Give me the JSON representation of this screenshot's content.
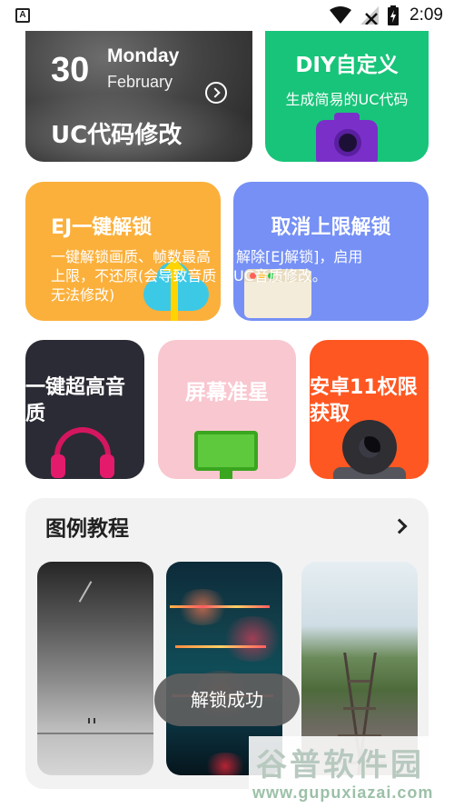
{
  "status_bar": {
    "app_badge": "A",
    "time": "2:09"
  },
  "date_card": {
    "day": "30",
    "weekday": "Monday",
    "month": "February",
    "title": "UC代码修改"
  },
  "diy_card": {
    "title": "DIY自定义",
    "subtitle": "生成简易的UC代码"
  },
  "ej_card": {
    "title": "EJ一键解锁",
    "description": "一键解锁画质、帧数最高上限，不还原(会导致音质无法修改)"
  },
  "cancel_card": {
    "title": "取消上限解锁",
    "description_line1": "解除[EJ解锁]，启用",
    "description_line2": "UC音质修改。"
  },
  "audio_card": {
    "title": "一键超高音质"
  },
  "crosshair_card": {
    "title": "屏幕准星"
  },
  "permission_card": {
    "title": "安卓11权限获取"
  },
  "tutorial": {
    "title": "图例教程"
  },
  "toast": {
    "text": "解锁成功"
  },
  "watermark": {
    "main": "谷普软件园",
    "url": "www.gupuxiazai.com"
  },
  "colors": {
    "green": "#18c47a",
    "orange": "#fbb03b",
    "blue": "#7690f5",
    "dark": "#2b2b35",
    "pink": "#f8c7d0",
    "red_orange": "#ff5722"
  },
  "icons": [
    "app-notification-icon",
    "wifi-icon",
    "signal-icon",
    "battery-charging-icon",
    "chevron-right-icon",
    "camera-icon",
    "upload-cloud-icon",
    "browser-window-icon",
    "headphones-icon",
    "monitor-icon",
    "webcam-icon"
  ]
}
